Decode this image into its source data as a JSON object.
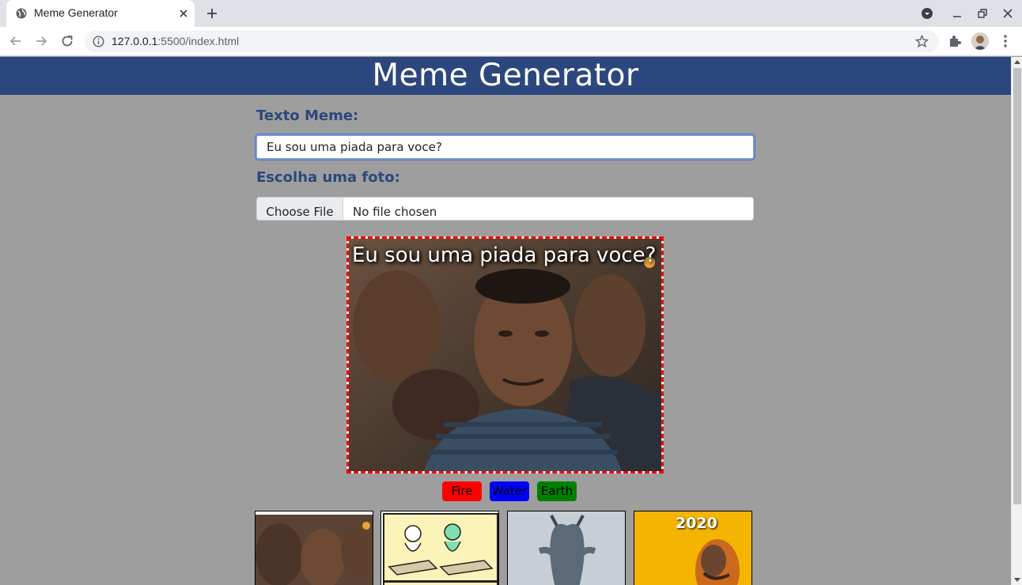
{
  "browser": {
    "tab_title": "Meme Generator",
    "url_host": "127.0.0.1",
    "url_rest": ":5500/index.html"
  },
  "page": {
    "title": "Meme Generator",
    "text_label": "Texto Meme:",
    "text_value": "Eu sou uma piada para voce?",
    "photo_label": "Escolha uma foto:",
    "file_button": "Choose File",
    "file_status": "No file chosen",
    "meme_caption": "Eu sou uma piada para voce?",
    "thumbnail_2_text": "2020"
  },
  "style_buttons": [
    {
      "label": "Fire",
      "color": "#ff0000"
    },
    {
      "label": "Water",
      "color": "#0000ff"
    },
    {
      "label": "Earth",
      "color": "#008000"
    }
  ],
  "colors": {
    "header": "#2c477d",
    "page_bg": "#9e9e9e",
    "frame_border": "#ff0000"
  }
}
